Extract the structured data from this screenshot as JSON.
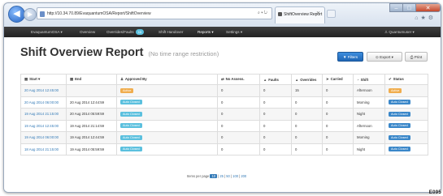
{
  "browser": {
    "url": "http://10.34.70.89/EvaquantumOSA/Report/ShiftOverview",
    "address_controls": "⌕ ▾ ↻",
    "tab_title": "ShiftOverview Report",
    "back_icon": "back-arrow-icon",
    "forward_icon": "forward-arrow-icon"
  },
  "nav": {
    "brand": "EvaquantumOSA ▾",
    "items": [
      {
        "label": "Overview"
      },
      {
        "label": "Overrides/Faults",
        "badge": "15"
      },
      {
        "label": "Shift Handover"
      },
      {
        "label": "Reports ▾",
        "active": true
      },
      {
        "label": "Settings ▾"
      }
    ],
    "user": "♙ Quantumuser ▾"
  },
  "page": {
    "title": "Shift Overview Report",
    "subtitle": "(No time range restriction)",
    "buttons": {
      "filters": "▼ Filters",
      "export": "⊙ Export ▾",
      "print": "⎙ Print"
    }
  },
  "table": {
    "headers": [
      {
        "icon": "calendar-icon",
        "glyph": "▦",
        "label": "Start ▾"
      },
      {
        "icon": "calendar-icon",
        "glyph": "▦",
        "label": "End"
      },
      {
        "icon": "user-icon",
        "glyph": "♟",
        "label": "Approved By"
      },
      {
        "icon": "link-icon",
        "glyph": "⇄",
        "label": "No Assess."
      },
      {
        "icon": "alert-icon",
        "glyph": "▲",
        "label": "Faults"
      },
      {
        "icon": "alert-icon",
        "glyph": "▲",
        "label": "Overrides"
      },
      {
        "icon": "plane-icon",
        "glyph": "➤",
        "label": "Carried"
      },
      {
        "icon": "time-icon",
        "glyph": "◔",
        "label": "Shift"
      },
      {
        "icon": "check-icon",
        "glyph": "✔",
        "label": "Status"
      }
    ],
    "rows": [
      {
        "start": "20 Aug 2014 12:45:00",
        "end": "",
        "approved": "Active",
        "approved_style": "warning",
        "no_assess": "0",
        "faults": "0",
        "overrides": "15",
        "carried": "0",
        "shift": "Afternoon",
        "status": "Active",
        "status_style": "warning"
      },
      {
        "start": "20 Aug 2014 06:00:00",
        "end": "20 Aug 2014 12:44:59",
        "approved": "Auto Closed",
        "approved_style": "info",
        "no_assess": "0",
        "faults": "0",
        "overrides": "0",
        "carried": "0",
        "shift": "Morning",
        "status": "Auto Closed",
        "status_style": "primary"
      },
      {
        "start": "19 Aug 2014 21:15:00",
        "end": "20 Aug 2014 05:59:59",
        "approved": "Auto Closed",
        "approved_style": "info",
        "no_assess": "0",
        "faults": "0",
        "overrides": "0",
        "carried": "0",
        "shift": "Night",
        "status": "Auto Closed",
        "status_style": "primary"
      },
      {
        "start": "19 Aug 2014 12:45:00",
        "end": "19 Aug 2014 21:14:59",
        "approved": "Auto Closed",
        "approved_style": "info",
        "no_assess": "0",
        "faults": "0",
        "overrides": "0",
        "carried": "0",
        "shift": "Afternoon",
        "status": "Auto Closed",
        "status_style": "primary"
      },
      {
        "start": "19 Aug 2014 06:00:00",
        "end": "19 Aug 2014 12:44:59",
        "approved": "Auto Closed",
        "approved_style": "info",
        "no_assess": "0",
        "faults": "0",
        "overrides": "0",
        "carried": "0",
        "shift": "Morning",
        "status": "Auto Closed",
        "status_style": "primary"
      },
      {
        "start": "18 Aug 2014 21:15:00",
        "end": "19 Aug 2014 05:59:59",
        "approved": "Auto Closed",
        "approved_style": "info",
        "no_assess": "0",
        "faults": "0",
        "overrides": "0",
        "carried": "0",
        "shift": "Night",
        "status": "Auto Closed",
        "status_style": "primary"
      }
    ]
  },
  "pager": {
    "label": "Items per page",
    "current": "10",
    "options": [
      "25",
      "50",
      "100",
      "200"
    ]
  },
  "footer_stamp": "E095",
  "colors": {
    "accent": "#337ab7",
    "nav_bg": "#2b2b2b",
    "label_warning": "#f0ad4e",
    "label_info": "#5bc0de",
    "label_primary": "#3a87c9"
  }
}
